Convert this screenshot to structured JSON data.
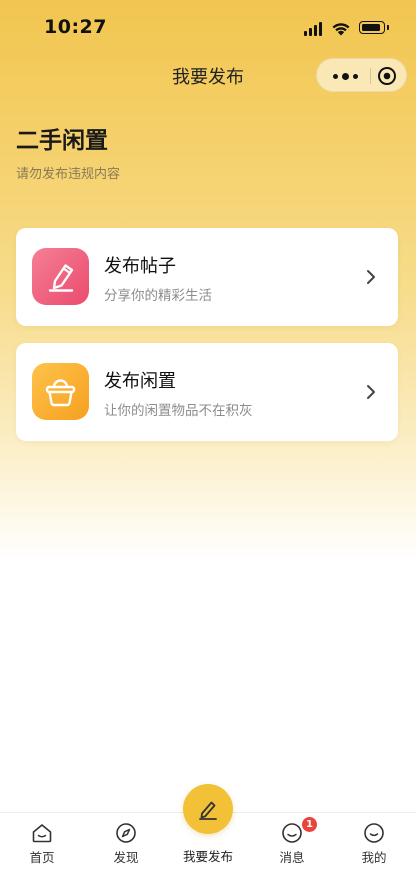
{
  "status_bar": {
    "time": "10:27"
  },
  "nav": {
    "title": "我要发布",
    "capsule_icons": [
      "more-icon",
      "target-icon"
    ]
  },
  "header": {
    "title": "二手闲置",
    "subtitle": "请勿发布违规内容"
  },
  "options": [
    {
      "title": "发布帖子",
      "description": "分享你的精彩生活",
      "icon": "edit-icon",
      "icon_color": "#EC5A78"
    },
    {
      "title": "发布闲置",
      "description": "让你的闲置物品不在积灰",
      "icon": "basket-icon",
      "icon_color": "#F8AE2C"
    }
  ],
  "tabbar": {
    "items": [
      {
        "label": "首页",
        "icon": "home-icon"
      },
      {
        "label": "发现",
        "icon": "compass-icon"
      },
      {
        "label": "我要发布",
        "icon": "pencil-icon",
        "active": true
      },
      {
        "label": "消息",
        "icon": "chat-icon",
        "badge": "1"
      },
      {
        "label": "我的",
        "icon": "profile-icon"
      }
    ]
  },
  "colors": {
    "accent": "#F2C137",
    "badge": "#E8453C",
    "background_top": "#F1C54F"
  }
}
